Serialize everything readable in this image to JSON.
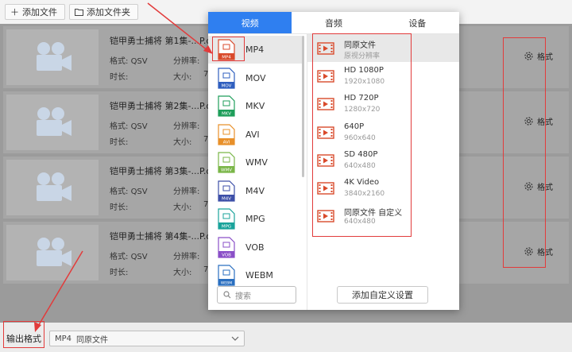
{
  "toolbar": {
    "add_file": "添加文件",
    "add_folder": "添加文件夹"
  },
  "files": [
    {
      "name": "铠甲勇士捕将 第1集-...P.q",
      "format_label": "格式:",
      "format": "QSV",
      "res_label": "分辨率:",
      "duration_label": "时长:",
      "size_label": "大小:",
      "duration_frag": "7",
      "gear_label": "格式"
    },
    {
      "name": "铠甲勇士捕将 第2集-...P.q",
      "format_label": "格式:",
      "format": "QSV",
      "res_label": "分辨率:",
      "duration_label": "时长:",
      "size_label": "大小:",
      "duration_frag": "7",
      "gear_label": "格式"
    },
    {
      "name": "铠甲勇士捕将 第3集-...P.q",
      "format_label": "格式:",
      "format": "QSV",
      "res_label": "分辨率:",
      "duration_label": "时长:",
      "size_label": "大小:",
      "duration_frag": "7",
      "gear_label": "格式"
    },
    {
      "name": "铠甲勇士捕将 第4集-...P.q",
      "format_label": "格式:",
      "format": "QSV",
      "res_label": "分辨率:",
      "duration_label": "时长:",
      "size_label": "大小:",
      "duration_frag": "7",
      "gear_label": "格式"
    }
  ],
  "popup": {
    "tabs": [
      "视频",
      "音频",
      "设备"
    ],
    "active_tab": 0,
    "formats": [
      {
        "name": "MP4",
        "color": "#d94a2b"
      },
      {
        "name": "MOV",
        "color": "#2f5fbf"
      },
      {
        "name": "MKV",
        "color": "#1e9e5a"
      },
      {
        "name": "AVI",
        "color": "#e8902a"
      },
      {
        "name": "WMV",
        "color": "#7ab648"
      },
      {
        "name": "M4V",
        "color": "#3d4fa8"
      },
      {
        "name": "MPG",
        "color": "#1aa39b"
      },
      {
        "name": "VOB",
        "color": "#8a4fc7"
      },
      {
        "name": "WEBM",
        "color": "#2a6fc0"
      }
    ],
    "selected_format": 0,
    "presets": [
      {
        "title": "同原文件",
        "sub": "原视分辨率"
      },
      {
        "title": "HD 1080P",
        "sub": "1920x1080"
      },
      {
        "title": "HD 720P",
        "sub": "1280x720"
      },
      {
        "title": "640P",
        "sub": "960x640"
      },
      {
        "title": "SD 480P",
        "sub": "640x480"
      },
      {
        "title": "4K Video",
        "sub": "3840x2160"
      },
      {
        "title": "同原文件 自定义",
        "sub": "640x480"
      }
    ],
    "selected_preset": 0,
    "search_placeholder": "搜索",
    "add_custom": "添加自定义设置"
  },
  "bottom": {
    "label": "输出格式",
    "select_format": "MP4",
    "select_preset": "同原文件"
  },
  "colors": {
    "accent": "#2f7ff0",
    "annotation": "#e23b3b",
    "preset_icon": "#d94a2b"
  }
}
